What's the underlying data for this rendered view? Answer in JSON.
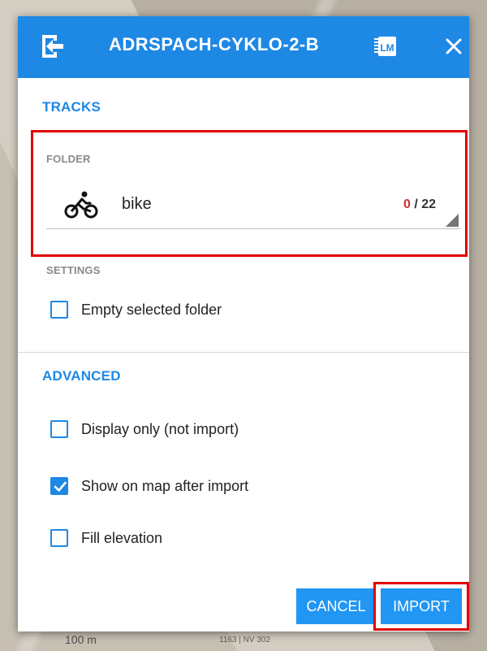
{
  "header": {
    "title": "ADRSPACH-CYKLO-2-B",
    "back_icon": "import-arrow-icon",
    "app_icon": "locus-map-icon",
    "close_icon": "close-icon"
  },
  "tracks": {
    "section_title": "TRACKS",
    "folder_label": "FOLDER",
    "folder": {
      "icon": "bike-icon",
      "name": "bike",
      "selected": "0",
      "separator": " / ",
      "total": "22"
    },
    "settings_label": "SETTINGS",
    "empty_folder": {
      "label": "Empty selected folder",
      "checked": false
    }
  },
  "advanced": {
    "section_title": "ADVANCED",
    "options": [
      {
        "label": "Display only (not import)",
        "checked": false
      },
      {
        "label": "Show on map after import",
        "checked": true
      },
      {
        "label": "Fill elevation",
        "checked": false
      }
    ]
  },
  "buttons": {
    "cancel": "CANCEL",
    "import": "IMPORT"
  },
  "map": {
    "scale_label": "100 m",
    "road_label": "1163 | NV 302"
  },
  "colors": {
    "accent": "#1e88e5",
    "highlight": "#e00000",
    "selected_count": "#d32f2f"
  }
}
